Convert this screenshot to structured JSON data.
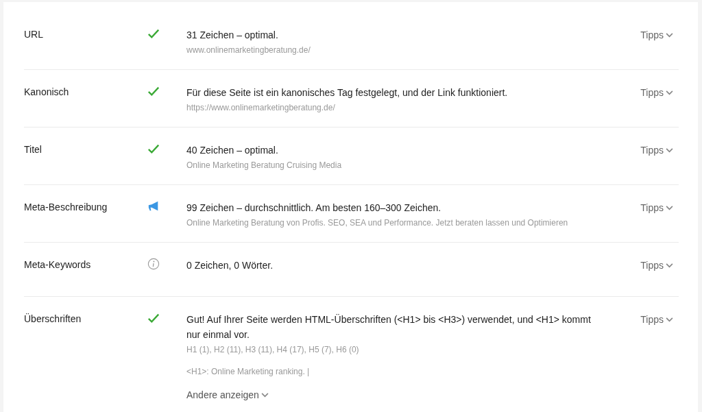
{
  "rows": [
    {
      "label": "URL",
      "kind": "ok",
      "message": "31 Zeichen – optimal.",
      "details": [
        "www.onlinemarketingberatung.de/"
      ],
      "tips": "Tipps"
    },
    {
      "label": "Kanonisch",
      "kind": "ok",
      "message": "Für diese Seite ist ein kanonisches Tag festgelegt, und der Link funktioniert.",
      "details": [
        "https://www.onlinemarketingberatung.de/"
      ],
      "tips": "Tipps"
    },
    {
      "label": "Titel",
      "kind": "ok",
      "message": "40 Zeichen – optimal.",
      "details": [
        "Online Marketing Beratung Cruising Media"
      ],
      "tips": "Tipps"
    },
    {
      "label": "Meta-Beschreibung",
      "kind": "warn",
      "message": "99 Zeichen – durchschnittlich. Am besten 160–300 Zeichen.",
      "details": [
        "Online Marketing Beratung von Profis. SEO, SEA und Performance. Jetzt beraten lassen und Optimieren"
      ],
      "tips": "Tipps"
    },
    {
      "label": "Meta-Keywords",
      "kind": "info",
      "message": "0 Zeichen, 0 Wörter.",
      "details": [],
      "tips": "Tipps"
    },
    {
      "label": "Überschriften",
      "kind": "ok",
      "message": "Gut! Auf Ihrer Seite werden HTML-Überschriften (<H1> bis <H3>) verwendet, und <H1> kommt nur einmal vor.",
      "details": [
        "H1 (1), H2 (11), H3 (11), H4 (17), H5 (7), H6 (0)"
      ],
      "note": "<H1>: Online Marketing ranking. |",
      "more": "Andere anzeigen",
      "tips": "Tipps"
    }
  ]
}
